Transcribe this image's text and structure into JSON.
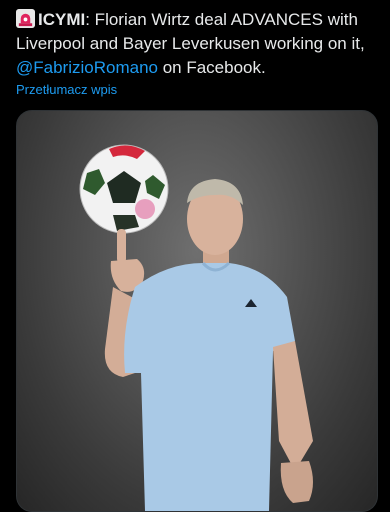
{
  "tweet": {
    "icymi": "ICYMI",
    "text_part1": ": Florian Wirtz deal ADVANCES with Liverpool and Bayer Leverkusen working on it, ",
    "mention": "@FabrizioRomano",
    "text_part2": " on Facebook.",
    "translate_label": "Przetłumacz wpis"
  },
  "icons": {
    "alert": "police-siren-icon"
  },
  "colors": {
    "link": "#1d9bf0",
    "text": "#e7e9ea",
    "background": "#000000",
    "shirt": "#a9c9e6"
  }
}
